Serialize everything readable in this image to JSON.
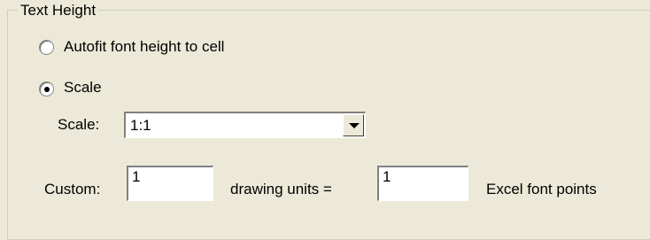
{
  "group": {
    "title": "Text Height"
  },
  "options": {
    "autofit": {
      "label": "Autofit font height to cell",
      "selected": false
    },
    "scale": {
      "label": "Scale",
      "selected": true
    }
  },
  "scale_field": {
    "label": "Scale:",
    "value": "1:1"
  },
  "custom": {
    "label": "Custom:",
    "drawing_units_value": "1",
    "drawing_units_label": "drawing units =",
    "font_points_value": "1",
    "font_points_label": "Excel font points"
  }
}
